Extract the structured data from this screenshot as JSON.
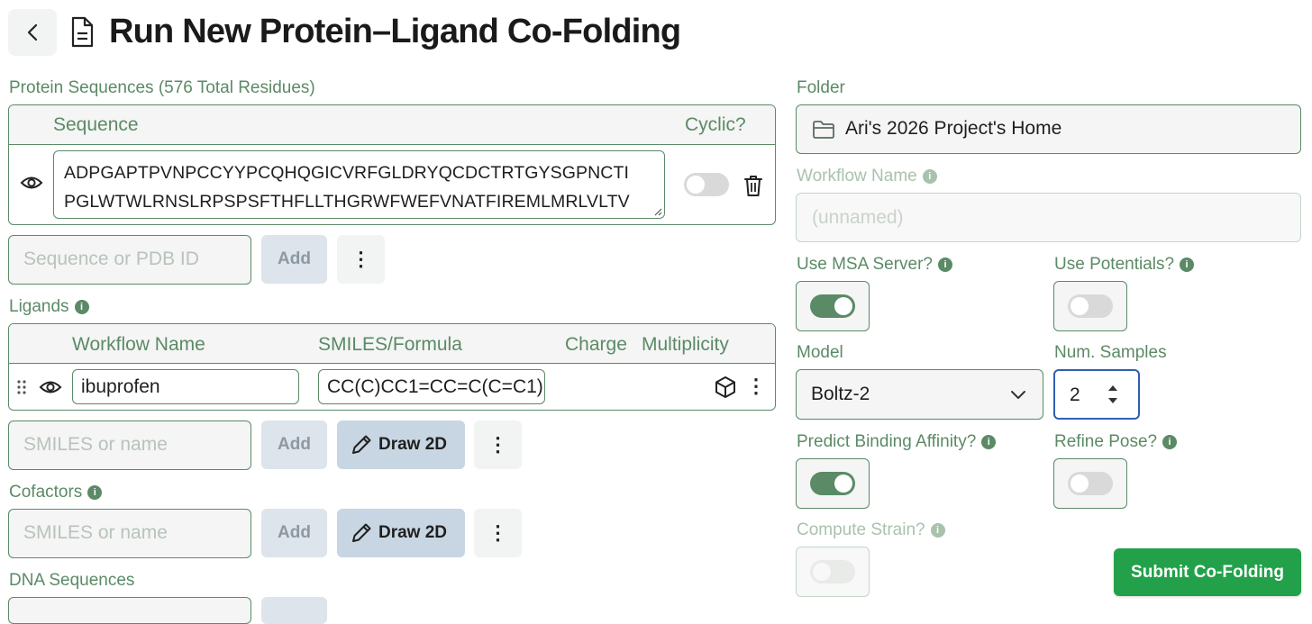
{
  "header": {
    "title": "Run New Protein–Ligand Co-Folding"
  },
  "protein": {
    "section_label": "Protein Sequences (576 Total Residues)",
    "col_sequence": "Sequence",
    "col_cyclic": "Cyclic?",
    "sequence_line1": "ADPGAPTPVNPCCYYPCQHQGICVRFGLDRYQCDCTRTGYSGPNCTI",
    "sequence_line2": "PGLWTWLRNSLRPSPSFTHFLLTHGRWFWEFVNATFIREMLMRLVLTV",
    "input_placeholder": "Sequence or PDB ID",
    "add_label": "Add",
    "menu_glyph": "⋮"
  },
  "ligands": {
    "section_label": "Ligands",
    "col_workflow_name": "Workflow Name",
    "col_smiles": "SMILES/Formula",
    "col_charge": "Charge",
    "col_multiplicity": "Multiplicity",
    "row_name": "ibuprofen",
    "row_smiles": "CC(C)CC1=CC=C(C=C1)",
    "input_placeholder": "SMILES or name",
    "add_label": "Add",
    "draw_label": "Draw 2D",
    "menu_glyph": "⋮"
  },
  "cofactors": {
    "section_label": "Cofactors",
    "input_placeholder": "SMILES or name",
    "add_label": "Add",
    "draw_label": "Draw 2D",
    "menu_glyph": "⋮"
  },
  "dna": {
    "section_label": "DNA Sequences"
  },
  "settings": {
    "folder_label": "Folder",
    "folder_value": "Ari's 2026 Project's Home",
    "workflow_name_label": "Workflow Name",
    "workflow_name_placeholder": "(unnamed)",
    "use_msa_label": "Use MSA Server?",
    "use_potentials_label": "Use Potentials?",
    "model_label": "Model",
    "model_value": "Boltz-2",
    "num_samples_label": "Num. Samples",
    "num_samples_value": "2",
    "predict_affinity_label": "Predict Binding Affinity?",
    "refine_pose_label": "Refine Pose?",
    "compute_strain_label": "Compute Strain?",
    "use_msa_on": true,
    "use_potentials_on": false,
    "predict_affinity_on": true,
    "refine_pose_on": false,
    "compute_strain_on": false
  },
  "submit": {
    "label": "Submit Co-Folding"
  },
  "colors": {
    "accent": "#5b8a66",
    "submit": "#22a14a"
  }
}
